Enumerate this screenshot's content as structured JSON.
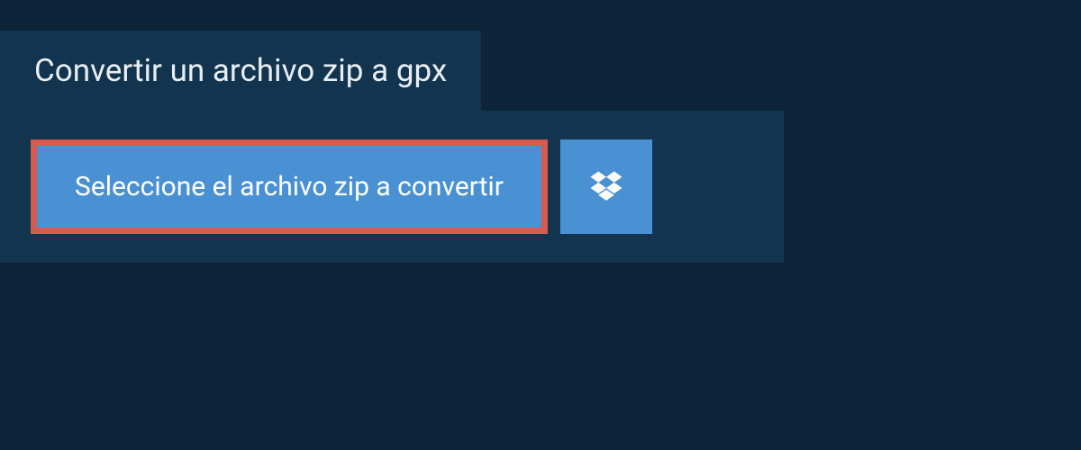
{
  "title": "Convertir un archivo zip a gpx",
  "select_button_label": "Seleccione el archivo zip a convertir"
}
